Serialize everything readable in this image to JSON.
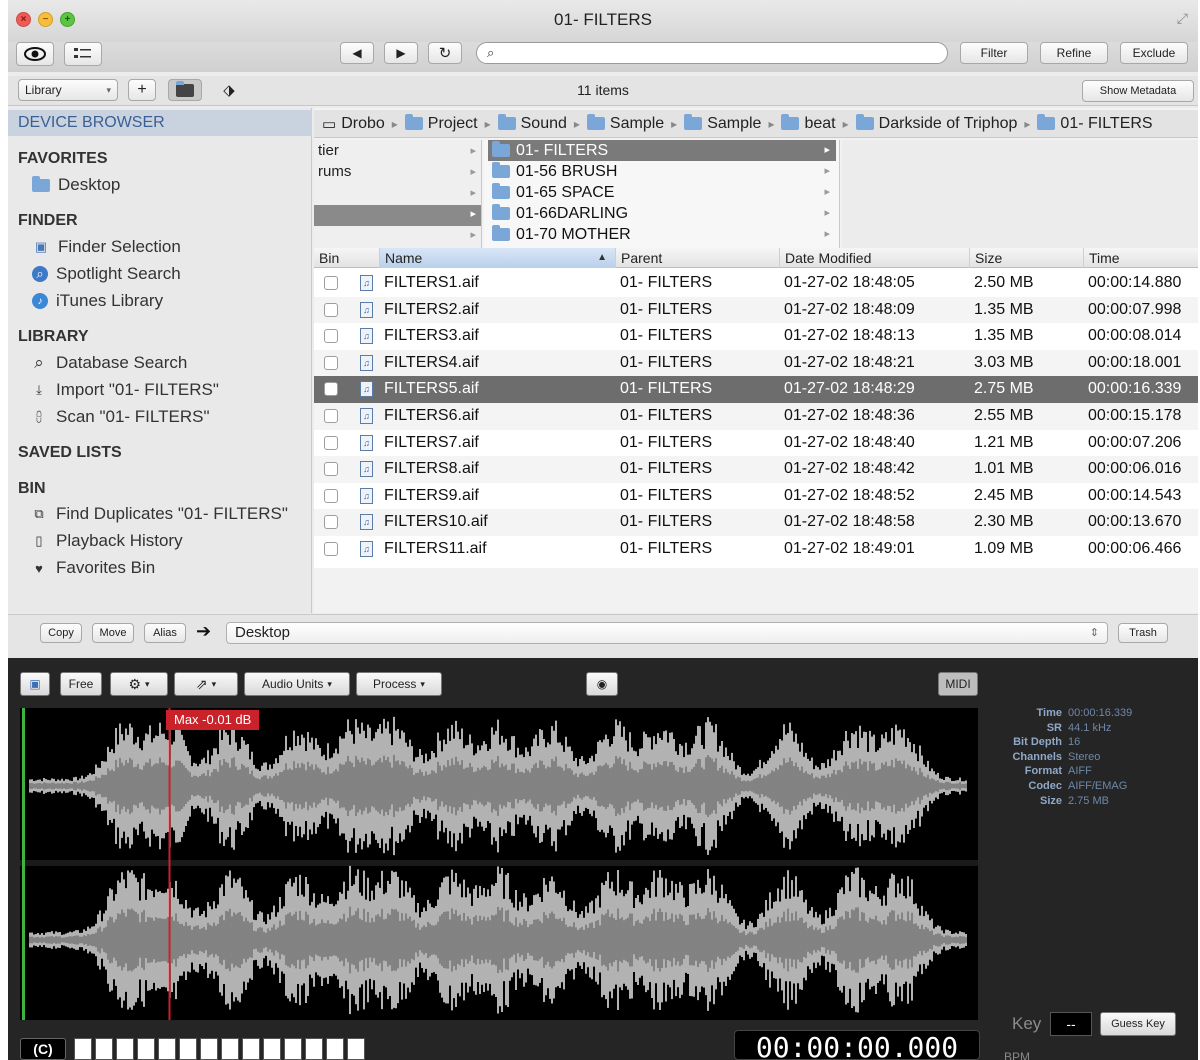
{
  "window": {
    "title": "01- FILTERS",
    "zoom_icon": "fullscreen-icon"
  },
  "toolbar": {
    "search_placeholder": "",
    "filter_label": "Filter",
    "refine_label": "Refine",
    "exclude_label": "Exclude"
  },
  "bar2": {
    "library_select": "Library",
    "add_label": "+",
    "items_count": "11 items",
    "show_metadata_label": "Show Metadata"
  },
  "sidebar": {
    "header": "DEVICE BROWSER",
    "sections": {
      "favorites": "FAVORITES",
      "finder": "FINDER",
      "library": "LIBRARY",
      "saved_lists": "SAVED LISTS",
      "bin": "BIN"
    },
    "favorites": [
      "Desktop"
    ],
    "finder": [
      "Finder Selection",
      "Spotlight Search",
      "iTunes Library"
    ],
    "library": [
      "Database Search",
      "Import \"01- FILTERS\"",
      "Scan \"01- FILTERS\""
    ],
    "bin": [
      "Find Duplicates \"01- FILTERS\"",
      "Playback History",
      "Favorites Bin"
    ]
  },
  "breadcrumbs": [
    "Drobo",
    "Project",
    "Sound",
    "Sample",
    "Sample",
    "beat",
    "Darkside of Triphop",
    "01- FILTERS"
  ],
  "column1": [
    "tier",
    "rums",
    "",
    "",
    ""
  ],
  "column2": [
    "01- FILTERS",
    "01-56 BRUSH",
    "01-65 SPACE",
    "01-66DARLING",
    "01-70 MOTHER"
  ],
  "table": {
    "headers": [
      "Bin",
      "Name",
      "Parent",
      "Date Modified",
      "Size",
      "Time"
    ],
    "sort_indicator": "▲",
    "selected_index": 4,
    "rows": [
      [
        "FILTERS1.aif",
        "01- FILTERS",
        "01-27-02 18:48:05",
        "2.50 MB",
        "00:00:14.880"
      ],
      [
        "FILTERS2.aif",
        "01- FILTERS",
        "01-27-02 18:48:09",
        "1.35 MB",
        "00:00:07.998"
      ],
      [
        "FILTERS3.aif",
        "01- FILTERS",
        "01-27-02 18:48:13",
        "1.35 MB",
        "00:00:08.014"
      ],
      [
        "FILTERS4.aif",
        "01- FILTERS",
        "01-27-02 18:48:21",
        "3.03 MB",
        "00:00:18.001"
      ],
      [
        "FILTERS5.aif",
        "01- FILTERS",
        "01-27-02 18:48:29",
        "2.75 MB",
        "00:00:16.339"
      ],
      [
        "FILTERS6.aif",
        "01- FILTERS",
        "01-27-02 18:48:36",
        "2.55 MB",
        "00:00:15.178"
      ],
      [
        "FILTERS7.aif",
        "01- FILTERS",
        "01-27-02 18:48:40",
        "1.21 MB",
        "00:00:07.206"
      ],
      [
        "FILTERS8.aif",
        "01- FILTERS",
        "01-27-02 18:48:42",
        "1.01 MB",
        "00:00:06.016"
      ],
      [
        "FILTERS9.aif",
        "01- FILTERS",
        "01-27-02 18:48:52",
        "2.45 MB",
        "00:00:14.543"
      ],
      [
        "FILTERS10.aif",
        "01- FILTERS",
        "01-27-02 18:48:58",
        "2.30 MB",
        "00:00:13.670"
      ],
      [
        "FILTERS11.aif",
        "01- FILTERS",
        "01-27-02 18:49:01",
        "1.09 MB",
        "00:00:06.466"
      ]
    ]
  },
  "bottombar": {
    "copy": "Copy",
    "move": "Move",
    "alias": "Alias",
    "destination": "Desktop",
    "trash": "Trash"
  },
  "player": {
    "free": "Free",
    "audio_units": "Audio Units",
    "process": "Process",
    "midi": "MIDI",
    "max_label": "Max -0.01 dB",
    "playhead_fraction": 0.155,
    "metadata": [
      [
        "Time",
        "00:00:16.339"
      ],
      [
        "SR",
        "44.1 kHz"
      ],
      [
        "Bit Depth",
        "16"
      ],
      [
        "Channels",
        "Stereo"
      ],
      [
        "Format",
        "AIFF"
      ],
      [
        "Codec",
        "AIFF/EMAG"
      ],
      [
        "Size",
        "2.75 MB"
      ]
    ],
    "key_label": "Key",
    "key_value": "--",
    "guess_key": "Guess Key",
    "c_label": "(C)",
    "timecode": "00:00:00.000",
    "bpm_label": "BPM"
  },
  "colors": {
    "accent_blue": "#3b5f93",
    "selection_gray": "#6d6d6d",
    "wave_white": "#ffffff",
    "wave_gray": "#8a8a8a",
    "playhead_red": "#c9222a",
    "start_green": "#3db43d"
  }
}
